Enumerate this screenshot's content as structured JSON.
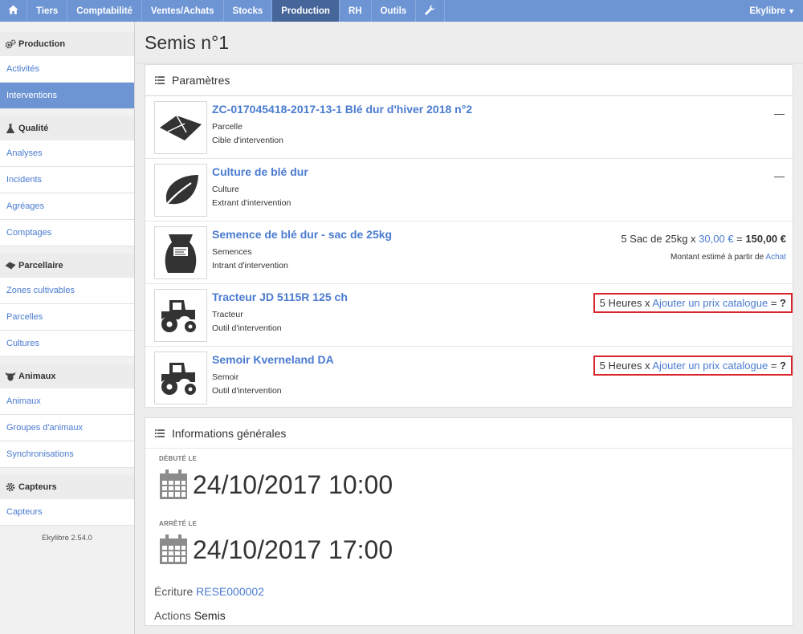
{
  "topbar": {
    "items": [
      "Tiers",
      "Comptabilité",
      "Ventes/Achats",
      "Stocks",
      "Production",
      "RH",
      "Outils"
    ],
    "active": "Production",
    "user": "Ekylibre",
    "home_icon": "home-icon",
    "tools_icon": "wrench-icon",
    "color": "#6d95d4",
    "active_color": "#46669a"
  },
  "sidebar": {
    "groups": [
      {
        "label": "Production",
        "icon": "gears-icon",
        "items": [
          "Activités",
          "Interventions"
        ]
      },
      {
        "label": "Qualité",
        "icon": "flask-icon",
        "items": [
          "Analyses",
          "Incidents",
          "Agréages",
          "Comptages"
        ]
      },
      {
        "label": "Parcellaire",
        "icon": "land-icon",
        "items": [
          "Zones cultivables",
          "Parcelles",
          "Cultures"
        ]
      },
      {
        "label": "Animaux",
        "icon": "cow-icon",
        "items": [
          "Animaux",
          "Groupes d'animaux",
          "Synchronisations"
        ]
      },
      {
        "label": "Capteurs",
        "icon": "gear-icon",
        "items": [
          "Capteurs"
        ]
      }
    ],
    "active_item": "Interventions",
    "version": "Ekylibre 2.54.0"
  },
  "page": {
    "title": "Semis n°1"
  },
  "parameters": {
    "title": "Paramètres",
    "rows": [
      {
        "name": "ZC-017045418-2017-13-1 Blé dur d'hiver 2018 n°2",
        "type": "Parcelle",
        "role": "Cible d'intervention",
        "dash": "—",
        "icon": "land-parcel-icon"
      },
      {
        "name": "Culture de blé dur",
        "type": "Culture",
        "role": "Extrant d'intervention",
        "dash": "—",
        "icon": "leaf-icon"
      },
      {
        "name": "Semence de blé dur - sac de 25kg",
        "type": "Semences",
        "role": "Intrant d'intervention",
        "icon": "seed-bag-icon",
        "amount": {
          "qty": "5 Sac de 25kg x",
          "price": "30,00 €",
          "eq": "=",
          "total": "150,00 €"
        },
        "estimate": {
          "text": "Montant estimé à partir de",
          "link": "Achat"
        }
      },
      {
        "name": "Tracteur JD 5115R 125 ch",
        "type": "Tracteur",
        "role": "Outil d'intervention",
        "icon": "tractor-icon",
        "price": {
          "qty": "5 Heures x",
          "link": "Ajouter un prix catalogue",
          "eq": "=",
          "total": "?"
        }
      },
      {
        "name": "Semoir Kverneland DA",
        "type": "Semoir",
        "role": "Outil d'intervention",
        "icon": "tractor-icon",
        "price": {
          "qty": "5 Heures x",
          "link": "Ajouter un prix catalogue",
          "eq": "=",
          "total": "?"
        }
      }
    ]
  },
  "general": {
    "title": "Informations générales",
    "started_label": "DÉBUTÉ LE",
    "started_value": "24/10/2017 10:00",
    "stopped_label": "ARRÊTÉ LE",
    "stopped_value": "24/10/2017 17:00",
    "entry_label": "Écriture",
    "entry_value": "RESE000002",
    "actions_label": "Actions",
    "actions_value": "Semis"
  }
}
